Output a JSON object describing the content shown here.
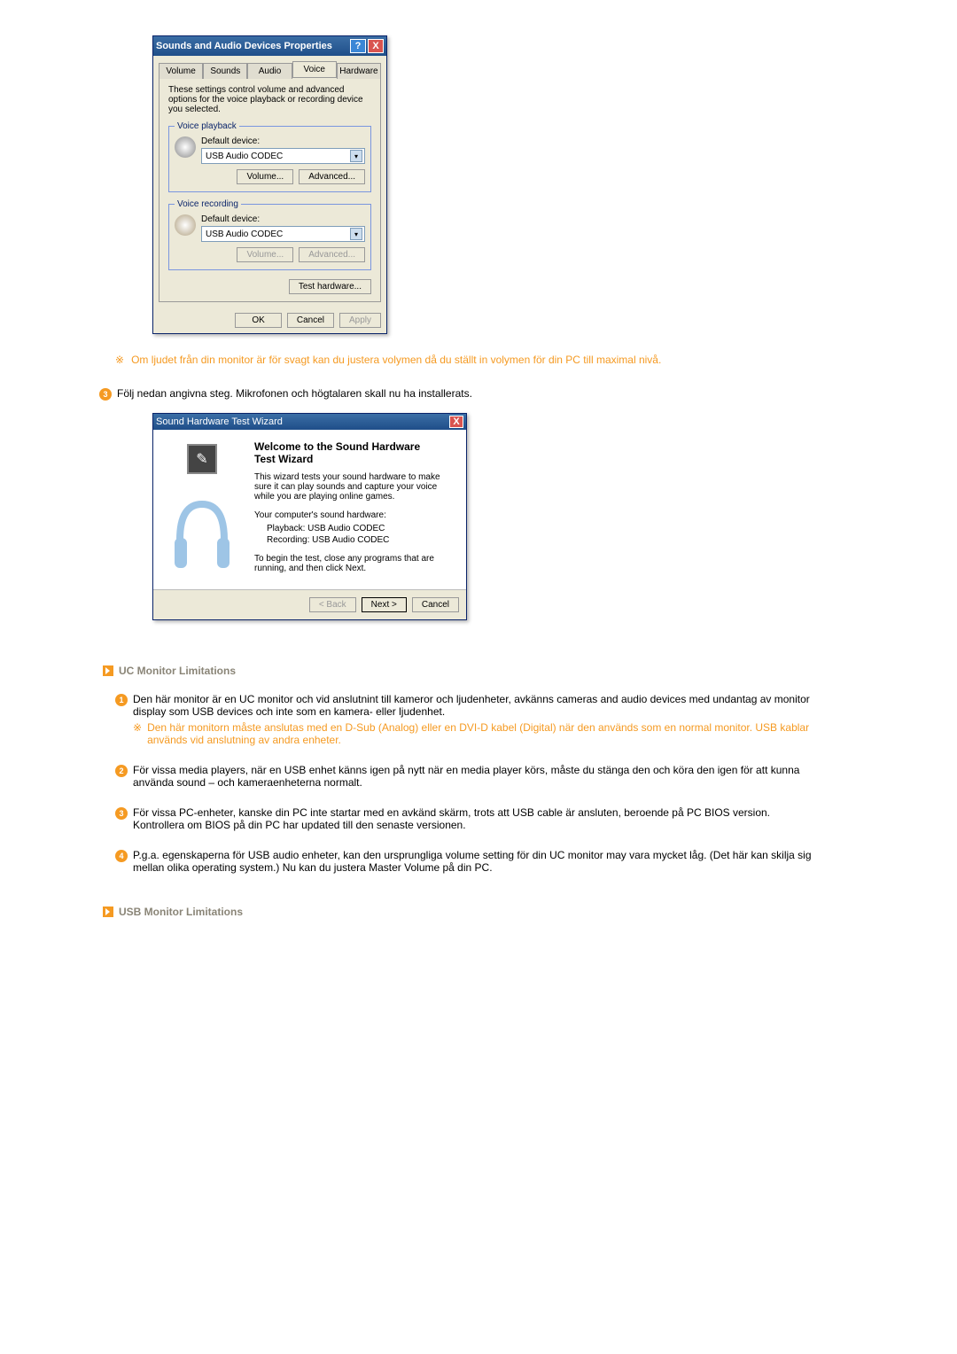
{
  "dialog1": {
    "title": "Sounds and Audio Devices Properties",
    "tabs": [
      "Volume",
      "Sounds",
      "Audio",
      "Voice",
      "Hardware"
    ],
    "desc": "These settings control volume and advanced options for the voice playback or recording device you selected.",
    "playback": {
      "legend": "Voice playback",
      "label": "Default device:",
      "value": "USB Audio CODEC",
      "vol": "Volume...",
      "adv": "Advanced..."
    },
    "recording": {
      "legend": "Voice recording",
      "label": "Default device:",
      "value": "USB Audio CODEC",
      "vol": "Volume...",
      "adv": "Advanced..."
    },
    "testhw": "Test hardware...",
    "ok": "OK",
    "cancel": "Cancel",
    "apply": "Apply"
  },
  "note_volume": "Om ljudet från din monitor är för svagt kan du justera volymen då du ställt in volymen för din PC till maximal nivå.",
  "step3": "Följ nedan angivna steg. Mikrofonen och högtalaren skall nu ha installerats.",
  "wizard": {
    "title": "Sound Hardware Test Wizard",
    "heading1": "Welcome to the Sound Hardware",
    "heading2": "Test Wizard",
    "p1": "This wizard tests your sound hardware to make sure it can play sounds and capture your voice while you are playing online games.",
    "p2": "Your computer's sound hardware:",
    "pb": "Playback: USB Audio CODEC",
    "rc": "Recording: USB Audio CODEC",
    "p3": "To begin the test, close any programs that are running, and then click Next.",
    "back": "< Back",
    "next": "Next >",
    "cancel": "Cancel"
  },
  "uc": {
    "title": "UC Monitor Limitations",
    "i1": "Den här monitor är en UC monitor och vid anslutnint till kameror och ljudenheter, avkänns cameras and audio devices med undantag av monitor display som USB devices och inte som en kamera- eller ljudenhet.",
    "i1note": "Den här monitorn måste anslutas med en D-Sub (Analog) eller en DVI-D kabel (Digital) när den används som en normal monitor. USB kablar används vid anslutning av andra enheter.",
    "i2": "För vissa media players, när en USB enhet känns igen på nytt när en media player körs, måste du stänga den och köra den igen för att kunna använda sound – och kameraenheterna normalt.",
    "i3a": "För vissa PC-enheter, kanske din PC inte startar med en avkänd skärm, trots att USB cable är ansluten, beroende på PC BIOS version.",
    "i3b": "Kontrollera om BIOS på din PC har updated till den senaste versionen.",
    "i4": "P.g.a. egenskaperna för USB audio enheter, kan den ursprungliga volume setting för din UC monitor may vara mycket låg. (Det här kan skilja sig mellan olika operating system.) Nu kan du justera Master Volume på din PC."
  },
  "usb": {
    "title": "USB Monitor Limitations"
  }
}
